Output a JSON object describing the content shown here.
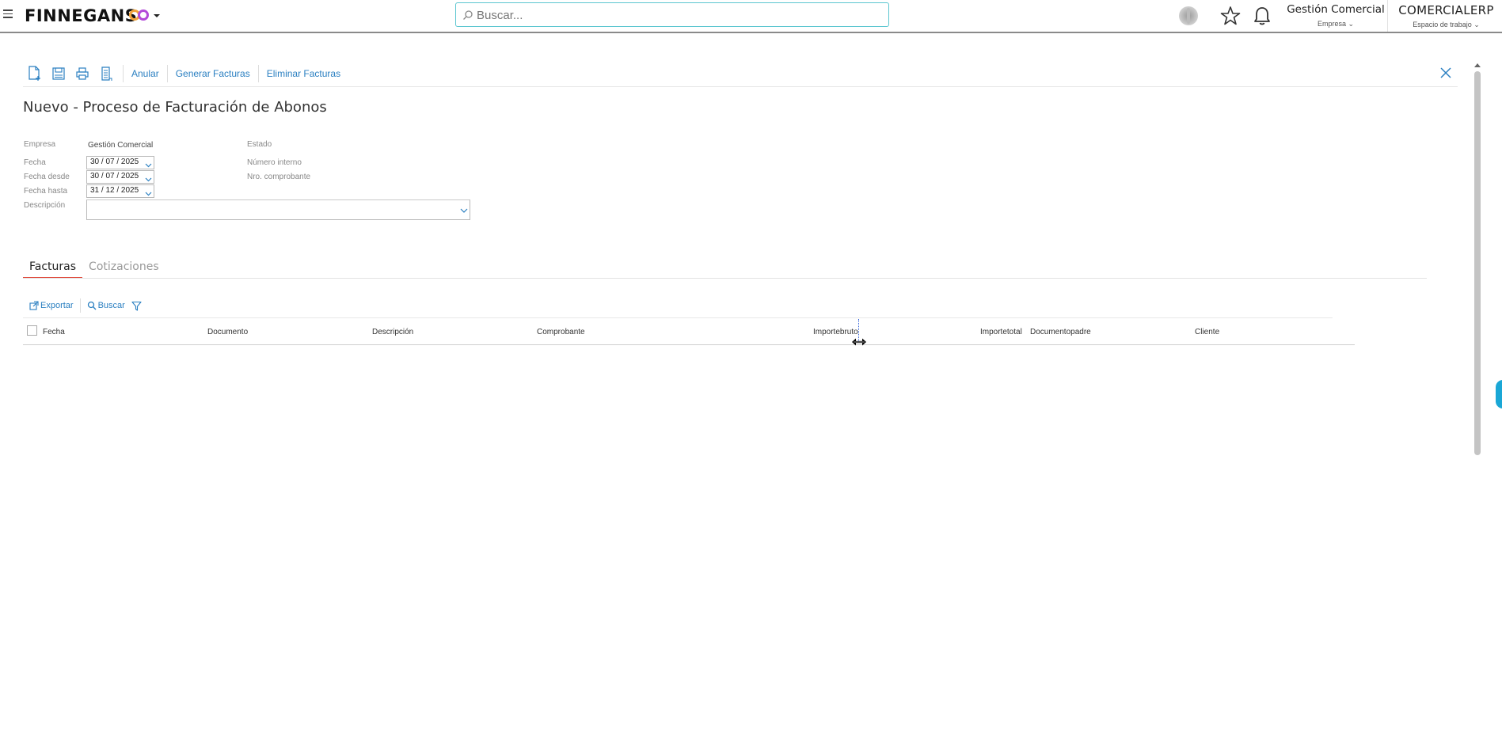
{
  "app": {
    "brand": "FINNEGANS",
    "brand_suffix": "CO",
    "colors": {
      "accent": "#2a7fc1",
      "tab_active": "#e04a3c",
      "search_border": "#5bc6d0",
      "bubble": "#1aa7d6"
    }
  },
  "header": {
    "search_placeholder": "Buscar...",
    "company_name": "Gestión Comercial",
    "company_sub": "Empresa",
    "workspace_name": "COMERCIALERP",
    "workspace_sub": "Espacio de trabajo",
    "icons": [
      "menu-icon",
      "search-icon",
      "ai-assistant-icon",
      "favorite-star-icon",
      "notification-bell-icon"
    ]
  },
  "toolbar": {
    "icons": [
      "new-document-icon",
      "save-icon",
      "print-icon",
      "copy-document-icon"
    ],
    "anular_label": "Anular",
    "generar_label": "Generar Facturas",
    "eliminar_label": "Eliminar Facturas"
  },
  "page": {
    "title": "Nuevo - Proceso de Facturación de Abonos"
  },
  "form": {
    "empresa_label": "Empresa",
    "empresa_value": "Gestión Comercial",
    "fecha_label": "Fecha",
    "fecha_value": "30 / 07 /  2025",
    "fecha_desde_label": "Fecha desde",
    "fecha_desde_value": "30 / 07 /  2025",
    "fecha_hasta_label": "Fecha hasta",
    "fecha_hasta_value": "31 / 12 /  2025",
    "descripcion_label": "Descripción",
    "descripcion_value": "",
    "estado_label": "Estado",
    "numero_interno_label": "Número interno",
    "nro_comprobante_label": "Nro. comprobante"
  },
  "tabs": [
    {
      "label": "Facturas",
      "active": true
    },
    {
      "label": "Cotizaciones",
      "active": false
    }
  ],
  "grid": {
    "exportar_label": "Exportar",
    "buscar_label": "Buscar",
    "columns": [
      "Fecha",
      "Documento",
      "Descripción",
      "Comprobante",
      "Importebruto",
      "Importetotal",
      "Documentopadre",
      "Cliente"
    ],
    "rows": []
  }
}
